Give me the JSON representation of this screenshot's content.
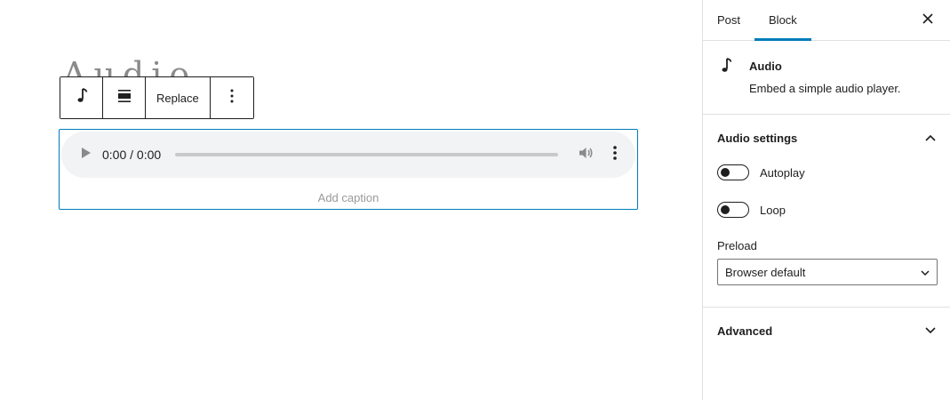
{
  "editor": {
    "block_title_partial": "Audio",
    "toolbar": {
      "block_type_icon": "music-note-icon",
      "align_icon": "align-center-icon",
      "replace_label": "Replace",
      "more_icon": "vertical-ellipsis-icon"
    },
    "audio": {
      "time": "0:00 / 0:00",
      "play_icon": "play-icon",
      "volume_icon": "volume-icon",
      "menu_icon": "vertical-ellipsis-icon",
      "caption_placeholder": "Add caption"
    }
  },
  "sidebar": {
    "tabs": [
      {
        "label": "Post"
      },
      {
        "label": "Block"
      }
    ],
    "close_icon": "close-icon",
    "block_card": {
      "icon": "music-note-icon",
      "title": "Audio",
      "description": "Embed a simple audio player."
    },
    "audio_settings": {
      "title": "Audio settings",
      "autoplay_label": "Autoplay",
      "loop_label": "Loop",
      "preload_label": "Preload",
      "preload_value": "Browser default"
    },
    "advanced": {
      "title": "Advanced"
    }
  },
  "colors": {
    "accent": "#007cba",
    "text": "#1e1e1e",
    "muted": "#9a9a9a"
  }
}
